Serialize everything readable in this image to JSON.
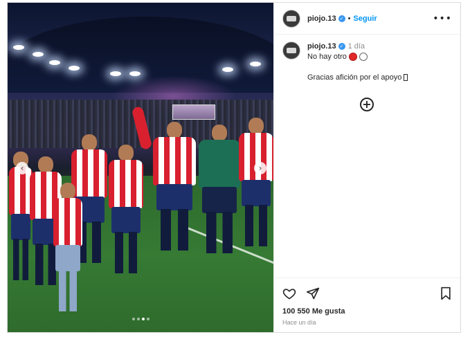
{
  "post": {
    "username": "piojo.13",
    "verified_icon": "verified-badge-icon",
    "separator": "•",
    "follow_label": "Seguir",
    "more_icon": "more-options-icon",
    "more_glyph": "•••"
  },
  "caption": {
    "username": "piojo.13",
    "time": "1 día",
    "line1": "No hay otro",
    "line2": "Gracias afición por el apoyo"
  },
  "load_more": {
    "icon": "add-circle-icon",
    "glyph": "+"
  },
  "actions": {
    "like_icon": "heart-icon",
    "share_icon": "send-icon",
    "save_icon": "bookmark-icon",
    "likes": "100 550 Me gusta",
    "posted": "Hace un día"
  },
  "carousel": {
    "prev_glyph": "‹",
    "next_glyph": "›",
    "slide_count": 4,
    "active_slide": 2
  },
  "colors": {
    "follow_blue": "#0095f6",
    "verified_blue": "#3897f0",
    "muted_gray": "#8e8e8e",
    "shirt_red": "#d8202f",
    "shorts_navy": "#1d2f6b"
  }
}
